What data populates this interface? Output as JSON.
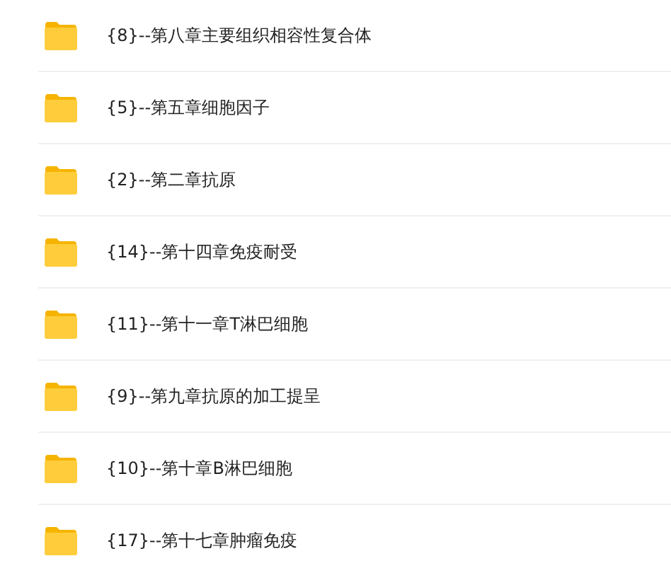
{
  "folders": [
    {
      "name": "{8}--第八章主要组织相容性复合体"
    },
    {
      "name": "{5}--第五章细胞因子"
    },
    {
      "name": "{2}--第二章抗原"
    },
    {
      "name": "{14}--第十四章免疫耐受"
    },
    {
      "name": "{11}--第十一章T淋巴细胞"
    },
    {
      "name": "{9}--第九章抗原的加工提呈"
    },
    {
      "name": "{10}--第十章B淋巴细胞"
    },
    {
      "name": "{17}--第十七章肿瘤免疫"
    }
  ]
}
